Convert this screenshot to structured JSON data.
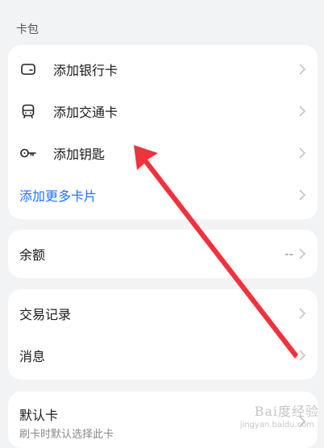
{
  "section_title": "卡包",
  "cards": {
    "add_bank_card": "添加银行卡",
    "add_transit_card": "添加交通卡",
    "add_key": "添加钥匙",
    "add_more_cards": "添加更多卡片"
  },
  "balance": {
    "label": "余额",
    "value": "--"
  },
  "records": {
    "transactions": "交易记录",
    "messages": "消息"
  },
  "default_card": {
    "label": "默认卡",
    "subtext": "刷卡时默认选择此卡"
  },
  "watermark": {
    "main": "Bai度经验",
    "sub": "jingyan.baidu.com"
  },
  "colors": {
    "accent_blue": "#256fff",
    "annotation_arrow": "#f0323c"
  }
}
